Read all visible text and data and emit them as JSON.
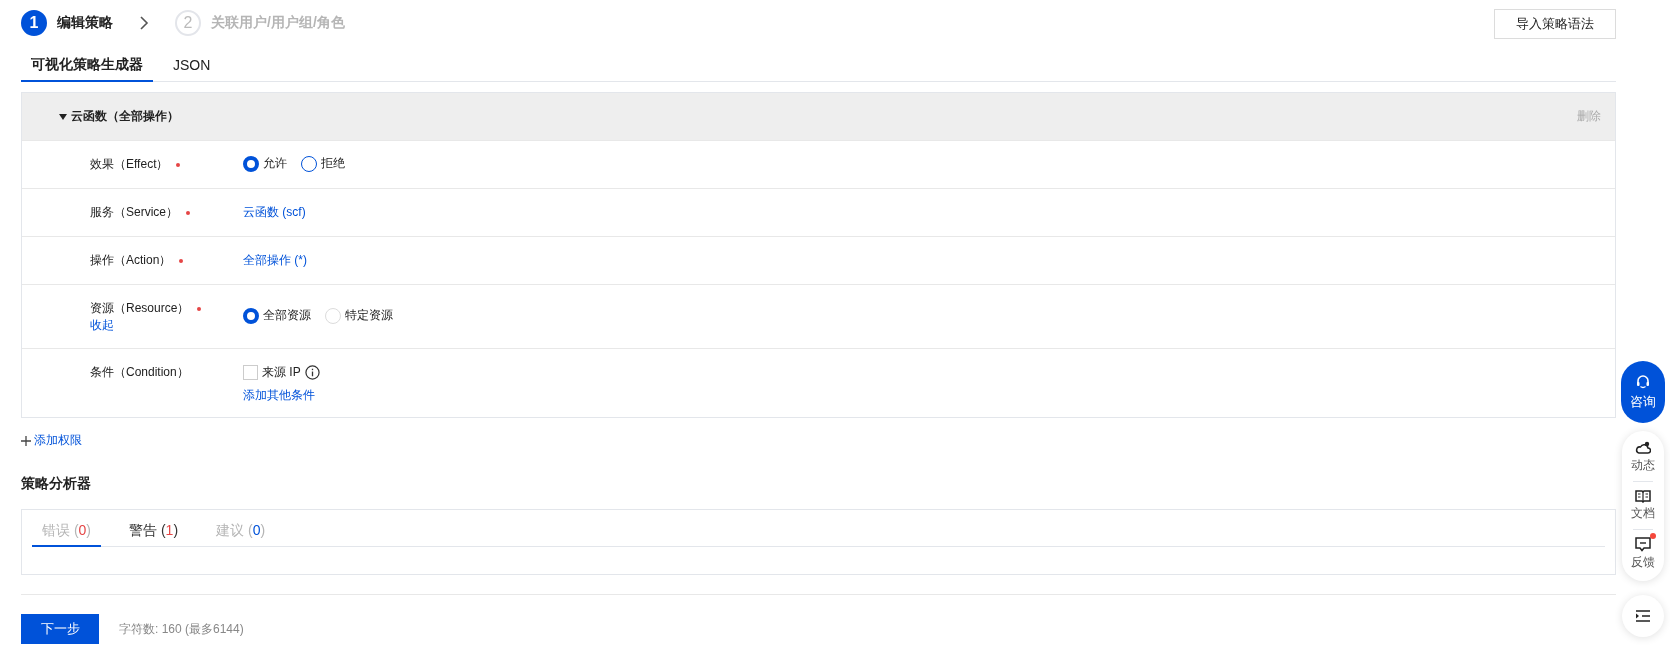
{
  "steps": [
    {
      "number": "1",
      "label": "编辑策略",
      "selected": true
    },
    {
      "number": "2",
      "label": "关联用户/用户组/角色",
      "selected": false
    }
  ],
  "import_button": "导入策略语法",
  "tabs": [
    {
      "label": "可视化策略生成器",
      "selected": true
    },
    {
      "label": "JSON",
      "selected": false
    }
  ],
  "rule": {
    "title": "云函数（全部操作）",
    "expanded": true,
    "delete": "删除",
    "fields": [
      {
        "kind": "radio",
        "label": "效果（Effect）",
        "required": true,
        "options": [
          {
            "label": "允许",
            "selected": true,
            "disabled": false
          },
          {
            "label": "拒绝",
            "selected": false,
            "disabled": false
          }
        ]
      },
      {
        "kind": "link",
        "label": "服务（Service）",
        "required": true,
        "value": "云函数 (scf)"
      },
      {
        "kind": "link",
        "label": "操作（Action）",
        "required": true,
        "value": "全部操作 (*)"
      },
      {
        "kind": "radio",
        "label": "资源（Resource）",
        "required": true,
        "sub_link": "收起",
        "options": [
          {
            "label": "全部资源",
            "selected": true,
            "disabled": false
          },
          {
            "label": "特定资源",
            "selected": false,
            "disabled": true
          }
        ]
      },
      {
        "kind": "checkbox",
        "label": "条件（Condition）",
        "required": false,
        "options": [
          {
            "label": "来源 IP",
            "checked": false,
            "info": true
          }
        ],
        "add_link": "添加其他条件"
      }
    ]
  },
  "add_permission": "添加权限",
  "analyzer": {
    "title": "策略分析器",
    "tabs": [
      {
        "label": "错误 (",
        "count": "0",
        "close": ")",
        "color": "#e54545",
        "selected": true,
        "disabled": true
      },
      {
        "label": "警告 (",
        "count": "1",
        "close": ")",
        "color": "#e54545",
        "selected": false,
        "disabled": false
      },
      {
        "label": "建议 (",
        "count": "0",
        "close": ")",
        "color": "#0052d9",
        "selected": false,
        "disabled": true
      }
    ]
  },
  "footer": {
    "next_button": "下一步",
    "char_count": "字符数: 160 (最多6144)"
  },
  "float_bar": {
    "consult": "咨询",
    "items": [
      {
        "kind": "cloud",
        "label": "动态",
        "badge": false
      },
      {
        "kind": "book",
        "label": "文档",
        "badge": false
      },
      {
        "kind": "feedback",
        "label": "反馈",
        "badge": true
      }
    ]
  }
}
